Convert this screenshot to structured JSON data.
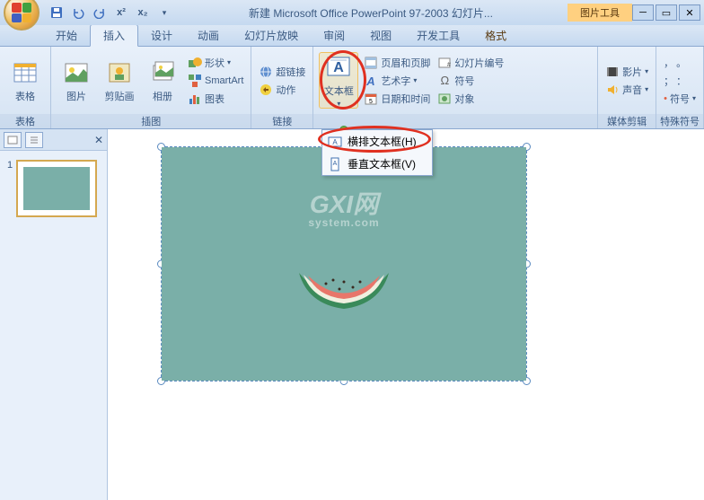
{
  "title": "新建 Microsoft Office PowerPoint 97-2003 幻灯片...",
  "context_tool": "图片工具",
  "tabs": {
    "home": "开始",
    "insert": "插入",
    "design": "设计",
    "anim": "动画",
    "slideshow": "幻灯片放映",
    "review": "审阅",
    "view": "视图",
    "dev": "开发工具",
    "format": "格式"
  },
  "ribbon": {
    "tables": {
      "label": "表格",
      "btn": "表格"
    },
    "illus": {
      "label": "插图",
      "picture": "图片",
      "clipart": "剪贴画",
      "album": "相册",
      "shapes": "形状",
      "smartart": "SmartArt",
      "chart": "图表"
    },
    "links": {
      "label": "链接",
      "hyperlink": "超链接",
      "action": "动作"
    },
    "text": {
      "label": "",
      "textbox": "文本框",
      "headerfooter": "页眉和页脚",
      "slidenum": "幻灯片编号",
      "wordart": "艺术字",
      "symbol": "符号",
      "datetime": "日期和时间",
      "object": "对象"
    },
    "media": {
      "label": "媒体剪辑",
      "movie": "影片",
      "sound": "声音"
    },
    "special": {
      "label": "特殊符号",
      "symbol": "符号"
    }
  },
  "dropdown": {
    "horiz": "横排文本框(H)",
    "vert": "垂直文本框(V)"
  },
  "thumb_num": "1",
  "watermark_main": "GXI网",
  "watermark_sub": "system.com"
}
